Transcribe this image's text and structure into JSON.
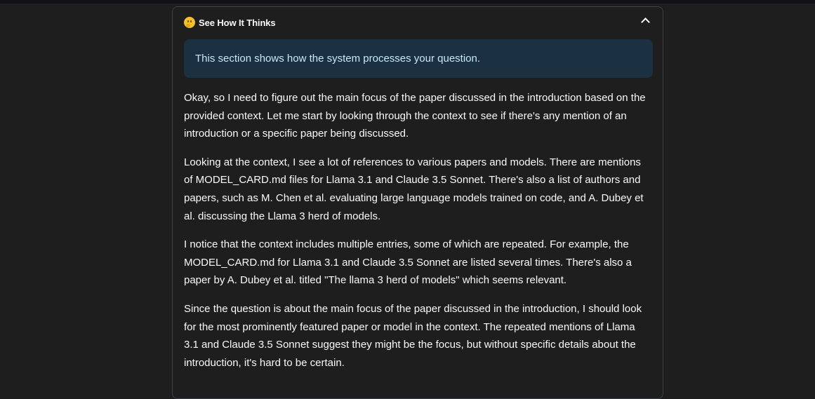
{
  "expander": {
    "title": "See How It Thinks",
    "icon": "thinking-face-emoji",
    "expanded": true
  },
  "info": {
    "text": "This section shows how the system processes your question."
  },
  "paragraphs": [
    "Okay, so I need to figure out the main focus of the paper discussed in the introduction based on the provided context. Let me start by looking through the context to see if there's any mention of an introduction or a specific paper being discussed.",
    "Looking at the context, I see a lot of references to various papers and models. There are mentions of MODEL_CARD.md files for Llama 3.1 and Claude 3.5 Sonnet. There's also a list of authors and papers, such as M. Chen et al. evaluating large language models trained on code, and A. Dubey et al. discussing the Llama 3 herd of models.",
    "I notice that the context includes multiple entries, some of which are repeated. For example, the MODEL_CARD.md for Llama 3.1 and Claude 3.5 Sonnet are listed several times. There's also a paper by A. Dubey et al. titled \"The llama 3 herd of models\" which seems relevant.",
    "Since the question is about the main focus of the paper discussed in the introduction, I should look for the most prominently featured paper or model in the context. The repeated mentions of Llama 3.1 and Claude 3.5 Sonnet suggest they might be the focus, but without specific details about the introduction, it's hard to be certain."
  ],
  "colors": {
    "background": "#1e1e1e",
    "info_background": "#1b3142",
    "info_text": "#c7e8f5",
    "text": "#fafafa",
    "border": "#3d3f47"
  }
}
